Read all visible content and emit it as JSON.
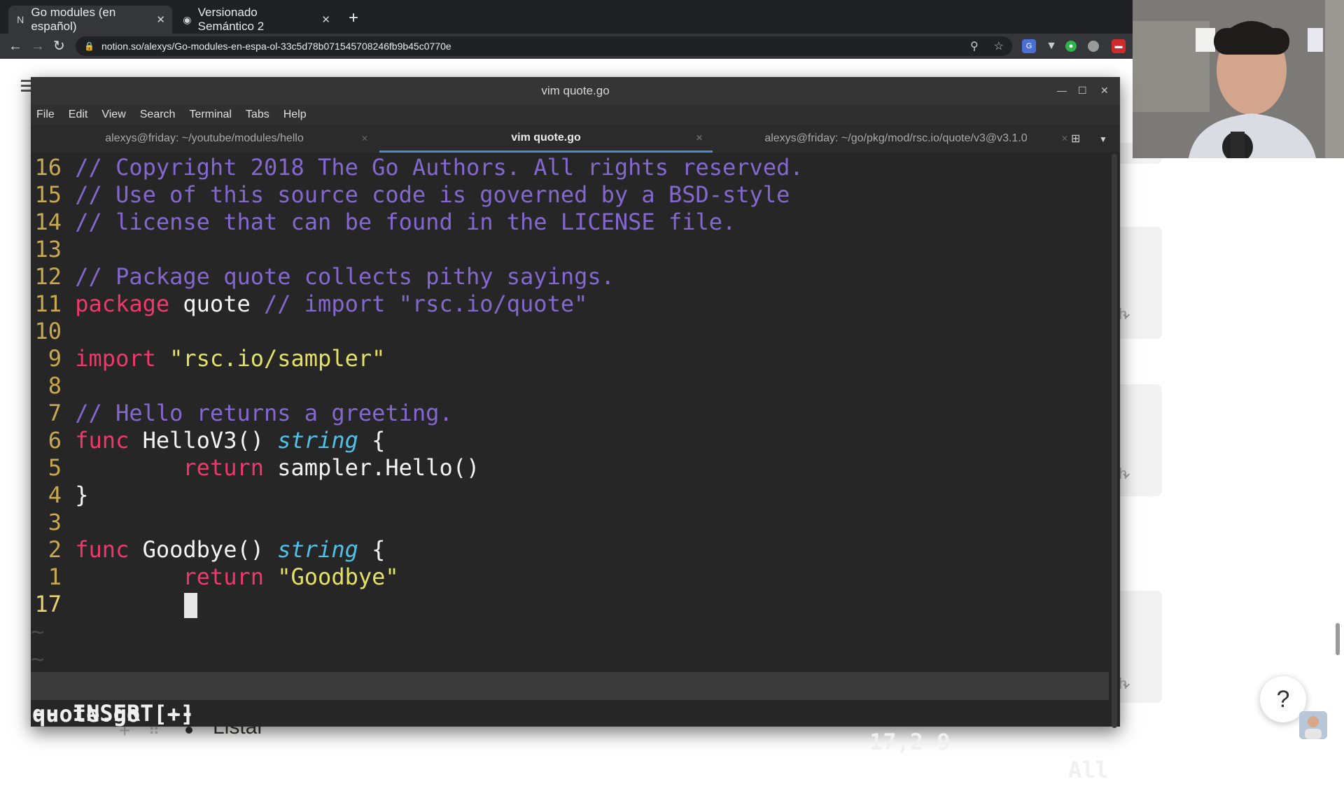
{
  "browser": {
    "tabs": [
      {
        "title": "Go modules (en español)",
        "active": true
      },
      {
        "title": "Versionado Semántico 2",
        "active": false
      }
    ],
    "new_tab": "+",
    "url": "notion.so/alexys/Go-modules-en-espa-ol-33c5d78b071545708246fb9b45c0770e"
  },
  "page": {
    "list_item": "Listar",
    "help": "?",
    "hidden_fragment": "h"
  },
  "terminal": {
    "window_title": "vim quote.go",
    "menu": [
      "File",
      "Edit",
      "View",
      "Search",
      "Terminal",
      "Tabs",
      "Help"
    ],
    "tabs": [
      {
        "label": "alexys@friday: ~/youtube/modules/hello",
        "active": false
      },
      {
        "label": "vim quote.go",
        "active": true
      },
      {
        "label": "alexys@friday: ~/go/pkg/mod/rsc.io/quote/v3@v3.1.0",
        "active": false
      }
    ],
    "lines": [
      {
        "num": "16",
        "segments": [
          {
            "t": "// Copyright 2018 The Go Authors. All rights reserved.",
            "c": "com"
          }
        ]
      },
      {
        "num": "15",
        "segments": [
          {
            "t": "// Use of this source code is governed by a BSD-style",
            "c": "com"
          }
        ]
      },
      {
        "num": "14",
        "segments": [
          {
            "t": "// license that can be found in the LICENSE file.",
            "c": "com"
          }
        ]
      },
      {
        "num": "13",
        "segments": []
      },
      {
        "num": "12",
        "segments": [
          {
            "t": "// Package quote collects pithy sayings.",
            "c": "com"
          }
        ]
      },
      {
        "num": "11",
        "segments": [
          {
            "t": "package",
            "c": "kw"
          },
          {
            "t": " quote ",
            "c": "code"
          },
          {
            "t": "// import \"rsc.io/quote\"",
            "c": "com"
          }
        ]
      },
      {
        "num": "10",
        "segments": []
      },
      {
        "num": "9",
        "segments": [
          {
            "t": "import",
            "c": "kw"
          },
          {
            "t": " ",
            "c": "code"
          },
          {
            "t": "\"rsc.io/sampler\"",
            "c": "str"
          }
        ]
      },
      {
        "num": "8",
        "segments": []
      },
      {
        "num": "7",
        "segments": [
          {
            "t": "// Hello returns a greeting.",
            "c": "com"
          }
        ]
      },
      {
        "num": "6",
        "segments": [
          {
            "t": "func",
            "c": "kw"
          },
          {
            "t": " HelloV3() ",
            "c": "code"
          },
          {
            "t": "string",
            "c": "type"
          },
          {
            "t": " {",
            "c": "code"
          }
        ]
      },
      {
        "num": "5",
        "segments": [
          {
            "t": "        ",
            "c": "code"
          },
          {
            "t": "return",
            "c": "kw"
          },
          {
            "t": " sampler.Hello()",
            "c": "code"
          }
        ]
      },
      {
        "num": "4",
        "segments": [
          {
            "t": "}",
            "c": "code"
          }
        ]
      },
      {
        "num": "3",
        "segments": []
      },
      {
        "num": "2",
        "segments": [
          {
            "t": "func",
            "c": "kw"
          },
          {
            "t": " Goodbye() ",
            "c": "code"
          },
          {
            "t": "string",
            "c": "type"
          },
          {
            "t": " {",
            "c": "code"
          }
        ]
      },
      {
        "num": "1",
        "segments": [
          {
            "t": "        ",
            "c": "code"
          },
          {
            "t": "return",
            "c": "kw"
          },
          {
            "t": " ",
            "c": "code"
          },
          {
            "t": "\"Goodbye\"",
            "c": "str"
          }
        ]
      },
      {
        "num": "17",
        "current": true,
        "cursor": true,
        "segments": [
          {
            "t": "        ",
            "c": "code"
          }
        ]
      }
    ],
    "tilde_lines": [
      "~",
      "~"
    ],
    "status": {
      "file": "quote.go [+]",
      "position": "17,2-9",
      "scroll": "All"
    },
    "mode": "-- INSERT --"
  },
  "colors": {
    "comment": "#8468cf",
    "keyword": "#f0386b",
    "string": "#e4e265",
    "type": "#4fc0e8",
    "line_number": "#c9a94f"
  }
}
